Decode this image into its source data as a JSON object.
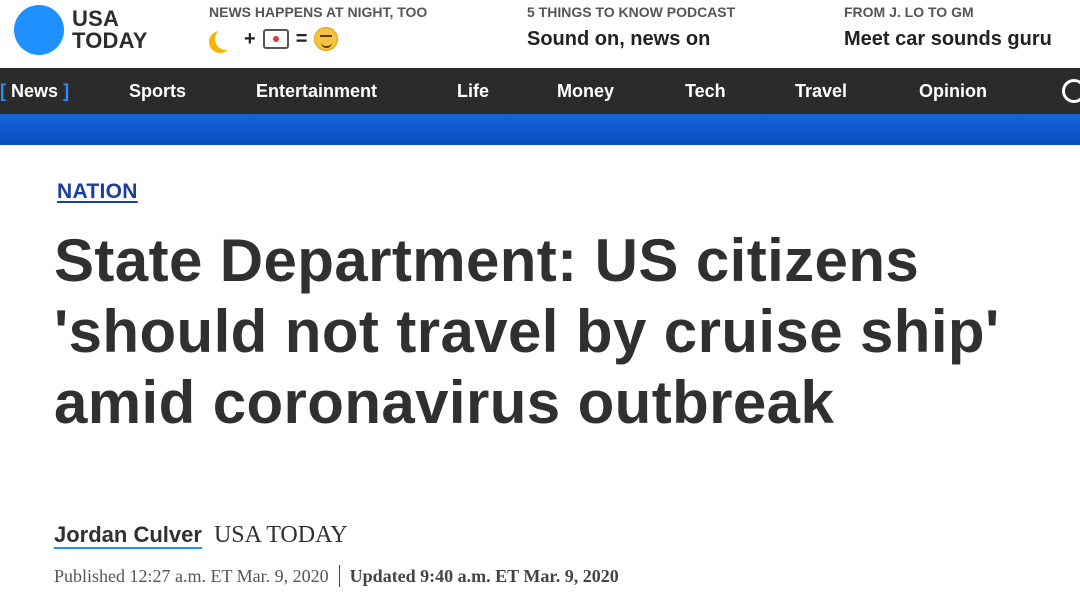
{
  "header": {
    "logo_line1": "USA",
    "logo_line2": "TODAY",
    "promos": [
      {
        "kicker": "NEWS HAPPENS AT NIGHT, TOO",
        "emoji": [
          "moon-icon",
          "+",
          "tv-icon",
          "=",
          "smile-icon"
        ]
      },
      {
        "kicker": "5 THINGS TO KNOW PODCAST",
        "headline": "Sound on, news on"
      },
      {
        "kicker": "FROM J. LO TO GM",
        "headline": "Meet car sounds guru"
      }
    ]
  },
  "nav": {
    "items": [
      "News",
      "Sports",
      "Entertainment",
      "Life",
      "Money",
      "Tech",
      "Travel",
      "Opinion"
    ],
    "active_bracket_open": "[",
    "active_bracket_close": "]",
    "search_icon": "search-icon"
  },
  "article": {
    "section": "NATION",
    "headline": "State Department: US citizens 'should not travel by cruise ship' amid coronavirus outbreak",
    "author": "Jordan Culver",
    "source": "USA TODAY",
    "published": "Published 12:27 a.m. ET Mar. 9, 2020",
    "updated": "Updated 9:40 a.m. ET Mar. 9, 2020"
  },
  "colors": {
    "brand_blue": "#1e90ff",
    "nav_bg": "#2b2b2b",
    "band_blue": "#0a4fc0",
    "section_link": "#1a3f9e"
  }
}
